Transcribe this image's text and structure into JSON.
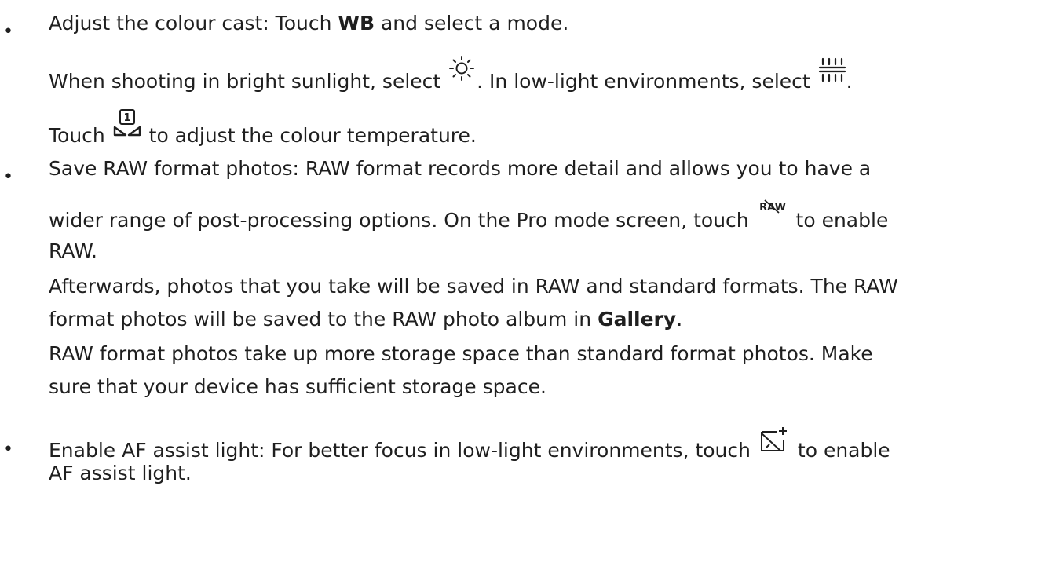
{
  "bullets": [
    {
      "line1": {
        "prefix": "Adjust the colour cast: Touch ",
        "bold": "WB",
        "suffix": " and select a mode."
      },
      "line2": {
        "before_sun": "When shooting in bright sunlight, select ",
        "icon_sun": "sun-icon",
        "between": ". In low-light environments, select ",
        "icon_fluor": "fluorescent-icon",
        "after": "."
      },
      "line3": {
        "before": "Touch ",
        "icon": "custom-white-balance-icon",
        "icon_number": "1",
        "after": " to adjust the colour temperature."
      }
    },
    {
      "line1": "Save RAW format photos: RAW format records more detail and allows you to have a",
      "line2": {
        "before": "wider range of post-processing options. On the Pro mode screen, touch ",
        "icon": "raw-icon",
        "icon_text": "RAW",
        "after": " to enable"
      },
      "line3": "RAW.",
      "line4": "Afterwards, photos that you take will be saved in RAW and standard formats. The RAW",
      "line5": {
        "prefix": "format photos will be saved to the RAW photo album in ",
        "bold": "Gallery",
        "suffix": "."
      },
      "line6": "RAW format photos take up more storage space than standard format photos. Make",
      "line7": "sure that your device has sufficient storage space."
    },
    {
      "line1": {
        "before": "Enable AF assist light: For better focus in low-light environments, touch ",
        "icon": "af-assist-light-icon",
        "after": " to enable"
      },
      "line2": "AF assist light."
    }
  ],
  "bullet_char": "•"
}
